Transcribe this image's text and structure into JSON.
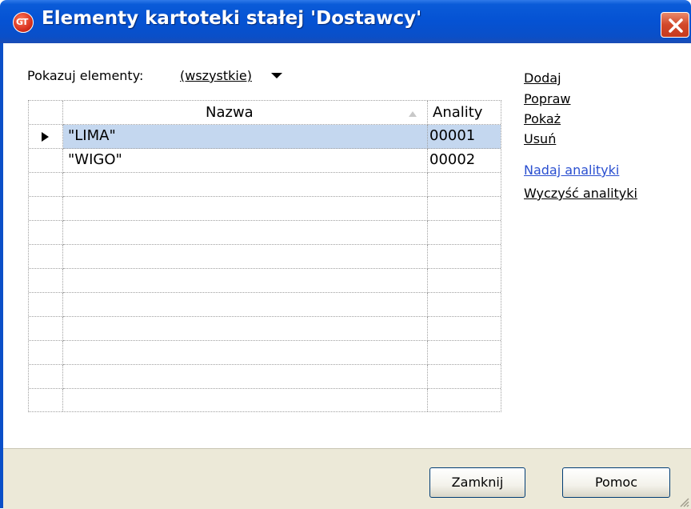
{
  "window": {
    "title": "Elementy kartoteki stałej 'Dostawcy'",
    "app_icon_text": "GT"
  },
  "filter": {
    "label": "Pokazuj elementy:",
    "value": "(wszystkie)"
  },
  "grid": {
    "columns": {
      "name": "Nazwa",
      "analytics": "Anality"
    },
    "rows": [
      {
        "name": "\"LIMA\"",
        "analytics": "00001",
        "selected": true
      },
      {
        "name": "\"WIGO\"",
        "analytics": "00002",
        "selected": false
      }
    ],
    "empty_rows": 10
  },
  "actions": {
    "add": "Dodaj",
    "edit": "Popraw",
    "show": "Pokaż",
    "delete": "Usuń",
    "assign_analytics": "Nadaj analityki",
    "clear_analytics": "Wyczyść analityki"
  },
  "buttons": {
    "close": "Zamknij",
    "help": "Pomoc"
  },
  "colors": {
    "titlebar": "#0552d3",
    "selection": "#c4d7ef",
    "link": "#2a4fd0",
    "panel": "#ece9d8"
  }
}
